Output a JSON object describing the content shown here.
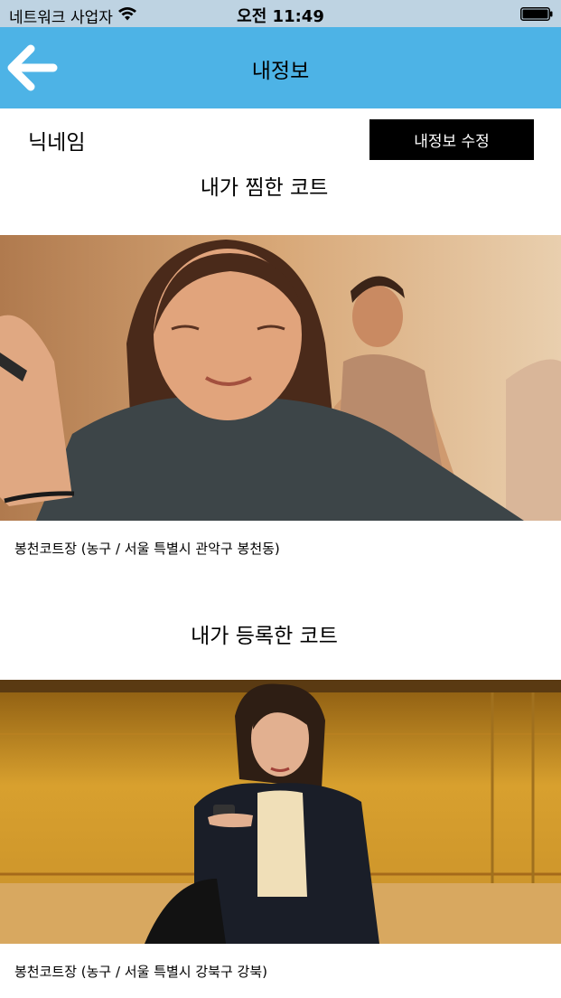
{
  "status_bar": {
    "carrier": "네트워크 사업자",
    "time": "오전 11:49",
    "icons": [
      "wifi-icon",
      "battery-icon"
    ]
  },
  "header": {
    "title": "내정보",
    "back_icon": "back-arrow-icon",
    "background_color": "#4db3e6"
  },
  "profile": {
    "nickname": "닉네임",
    "edit_button_label": "내정보 수정"
  },
  "liked_courts": {
    "title": "내가 찜한 코트",
    "items": [
      {
        "caption": "봉천코트장 (농구 / 서울 특별시 관악구 봉천동)"
      }
    ]
  },
  "registered_courts": {
    "title": "내가 등록한 코트",
    "items": [
      {
        "caption": "봉천코트장 (농구 / 서울 특별시 강북구 강북)"
      }
    ]
  }
}
